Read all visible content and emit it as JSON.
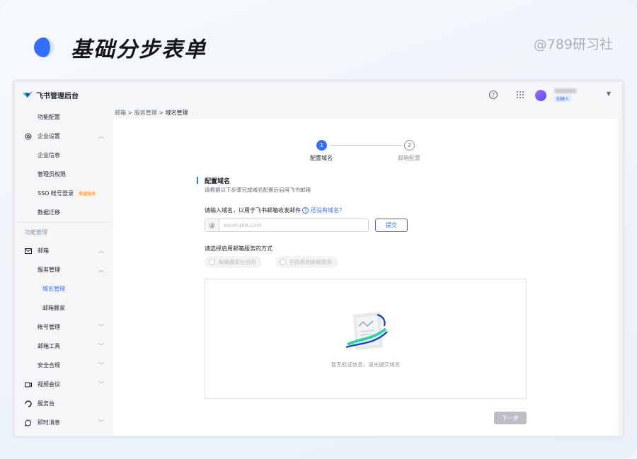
{
  "hero": {
    "title": "基础分步表单",
    "credit": "@789研习社"
  },
  "app": {
    "brand": "飞书管理后台",
    "user_role_badge": "创建人",
    "help_icon": "question-circle-icon",
    "apps_icon": "grid-icon"
  },
  "sidebar": {
    "top_item": "功能配置",
    "enterprise": {
      "label": "企业设置",
      "children": [
        "企业信息",
        "管理员权限",
        "SSO 帐号登录",
        "数据迁移"
      ],
      "sso_badge": "增值版本"
    },
    "section_title": "功能管理",
    "mail": {
      "label": "邮箱",
      "service_mgmt": "服务管理",
      "service_children": [
        "域名管理",
        "邮箱搬家"
      ],
      "others": [
        "帐号管理",
        "邮箱工具",
        "安全合规"
      ]
    },
    "video": "视频会议",
    "service_desk": "服务台",
    "im": "即时消息"
  },
  "breadcrumb": {
    "items": [
      "邮箱",
      "服务管理"
    ],
    "current": "域名管理",
    "sep": ">"
  },
  "steps": [
    {
      "num": "1",
      "label": "配置域名",
      "active": true
    },
    {
      "num": "2",
      "label": "邮箱配置",
      "active": false
    }
  ],
  "form": {
    "section_title": "配置域名",
    "section_desc": "请根据以下步骤完成域名配置后启用飞书邮箱",
    "domain_label": "请输入域名，以用于飞书邮箱收发邮件",
    "no_domain_link": "还没有域名?",
    "input_prefix": "@",
    "input_placeholder": "example.com",
    "input_value": "",
    "submit": "提交",
    "method_label": "请选择启用邮箱服务的方式",
    "method_options": [
      "邮箱搬家后启用",
      "启用新的邮箱服务"
    ],
    "empty_text": "暂无验证信息，请先提交域名",
    "next": "下一步"
  },
  "colors": {
    "accent": "#3370ff",
    "disabled": "#bbbfc4"
  }
}
